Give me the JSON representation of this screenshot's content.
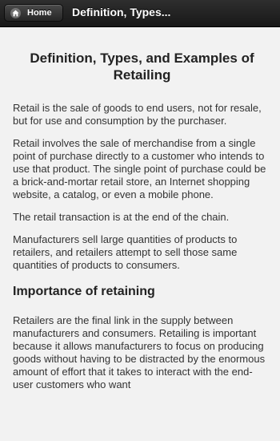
{
  "header": {
    "home_label": "Home",
    "title": "Definition, Types..."
  },
  "page": {
    "title": "Definition, Types, and Examples of Retailing",
    "paragraphs": [
      "Retail is the sale of goods to end users, not for resale, but for use and consumption by the purchaser.",
      "Retail involves the sale of merchandise from a single point of purchase directly to a customer who intends to use that product. The single point of purchase could be a brick-and-mortar retail store, an Internet shopping website, a catalog, or even a mobile phone.",
      "The retail transaction is at the end of the chain.",
      "Manufacturers sell large quantities of products to retailers, and retailers attempt to sell those same quantities of products to consumers."
    ],
    "section_heading": "Importance of retaining",
    "section_paragraph": "Retailers are the final link in the supply between manufacturers and consumers. Retailing is important because it allows manufacturers to focus on producing goods without having to be distracted by the enormous amount of effort that it takes to interact with the end-user customers who want"
  },
  "colors": {
    "header_bg": "#1e1e1e",
    "page_bg": "#f2f2f2",
    "text": "#333333"
  }
}
